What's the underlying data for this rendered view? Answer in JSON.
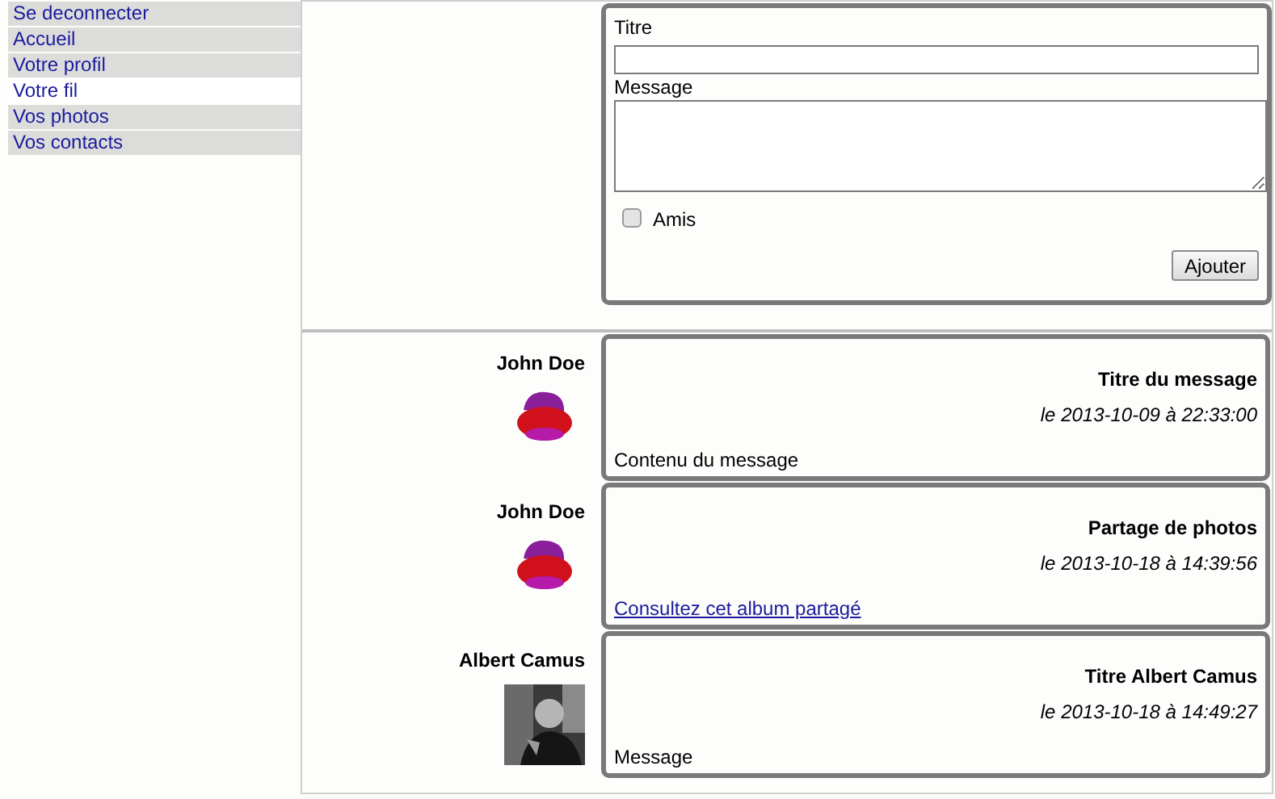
{
  "sidebar": {
    "items": [
      {
        "label": "Se deconnecter",
        "selected": false
      },
      {
        "label": "Accueil",
        "selected": false
      },
      {
        "label": "Votre profil",
        "selected": false
      },
      {
        "label": "Votre fil",
        "selected": true
      },
      {
        "label": "Vos photos",
        "selected": false
      },
      {
        "label": "Vos contacts",
        "selected": false
      }
    ]
  },
  "form": {
    "title_label": "Titre",
    "message_label": "Message",
    "checkbox": {
      "label": "Amis",
      "checked": false
    },
    "submit": "Ajouter"
  },
  "posts": [
    {
      "author": "John Doe",
      "avatar": {
        "kind": "cartoon"
      },
      "title": "Titre du message",
      "date": "le 2013-10-09 à 22:33:00",
      "body": {
        "kind": "text",
        "text": "Contenu du message"
      }
    },
    {
      "author": "John Doe",
      "avatar": {
        "kind": "cartoon"
      },
      "title": "Partage de photos",
      "date": "le 2013-10-18 à 14:39:56",
      "body": {
        "kind": "link",
        "text": "Consultez cet album partagé"
      }
    },
    {
      "author": "Albert Camus",
      "title": "Titre Albert Camus",
      "date": "le 2013-10-18 à 14:49:27",
      "body": {
        "kind": "text",
        "text": "Message"
      }
    }
  ]
}
